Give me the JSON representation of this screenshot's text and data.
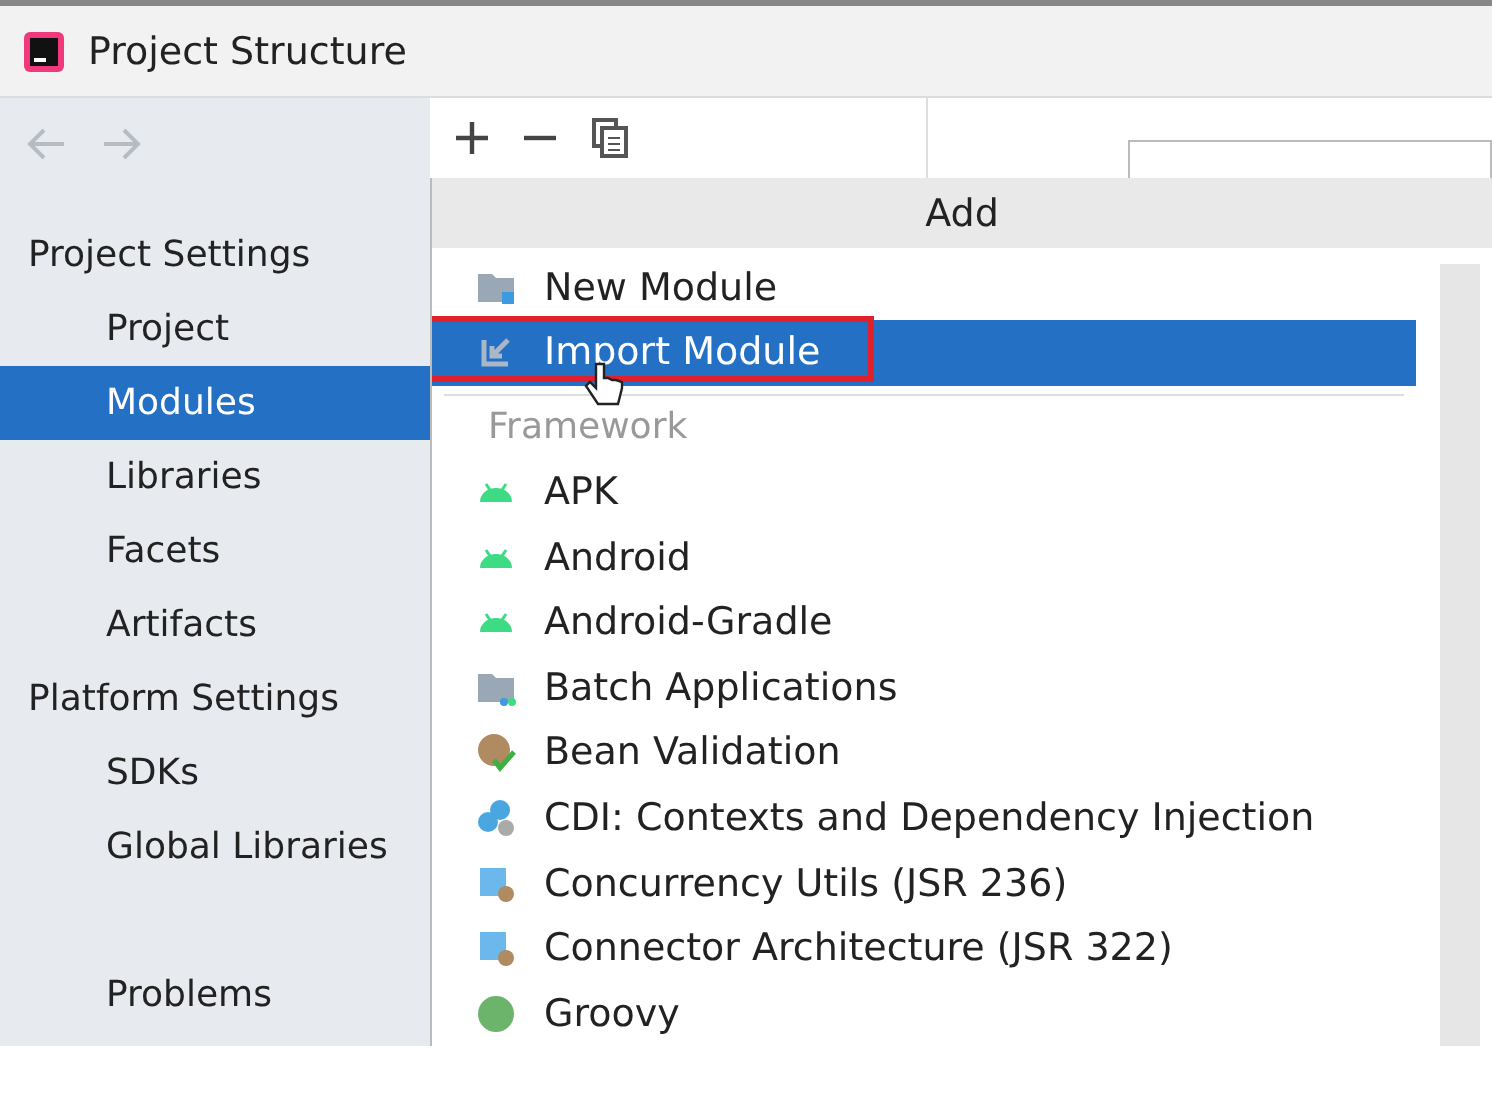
{
  "window": {
    "title": "Project Structure"
  },
  "sidebar": {
    "sections": [
      {
        "heading": "Project Settings",
        "items": [
          {
            "label": "Project",
            "selected": false
          },
          {
            "label": "Modules",
            "selected": true
          },
          {
            "label": "Libraries",
            "selected": false
          },
          {
            "label": "Facets",
            "selected": false
          },
          {
            "label": "Artifacts",
            "selected": false
          }
        ]
      },
      {
        "heading": "Platform Settings",
        "items": [
          {
            "label": "SDKs",
            "selected": false
          },
          {
            "label": "Global Libraries",
            "selected": false
          }
        ]
      }
    ],
    "footer_item": {
      "label": "Problems",
      "selected": false
    }
  },
  "popup": {
    "title": "Add",
    "items": [
      {
        "kind": "item",
        "label": "New Module",
        "selected": false,
        "highlighted": false
      },
      {
        "kind": "item",
        "label": "Import Module",
        "selected": true,
        "highlighted": true
      },
      {
        "kind": "section",
        "label": "Framework"
      },
      {
        "kind": "item",
        "label": "APK",
        "selected": false,
        "highlighted": false
      },
      {
        "kind": "item",
        "label": "Android",
        "selected": false,
        "highlighted": false
      },
      {
        "kind": "item",
        "label": "Android-Gradle",
        "selected": false,
        "highlighted": false
      },
      {
        "kind": "item",
        "label": "Batch Applications",
        "selected": false,
        "highlighted": false
      },
      {
        "kind": "item",
        "label": "Bean Validation",
        "selected": false,
        "highlighted": false
      },
      {
        "kind": "item",
        "label": "CDI: Contexts and Dependency Injection",
        "selected": false,
        "highlighted": false
      },
      {
        "kind": "item",
        "label": "Concurrency Utils (JSR 236)",
        "selected": false,
        "highlighted": false
      },
      {
        "kind": "item",
        "label": "Connector Architecture (JSR 322)",
        "selected": false,
        "highlighted": false
      },
      {
        "kind": "item",
        "label": "Groovy",
        "selected": false,
        "highlighted": false
      }
    ]
  }
}
